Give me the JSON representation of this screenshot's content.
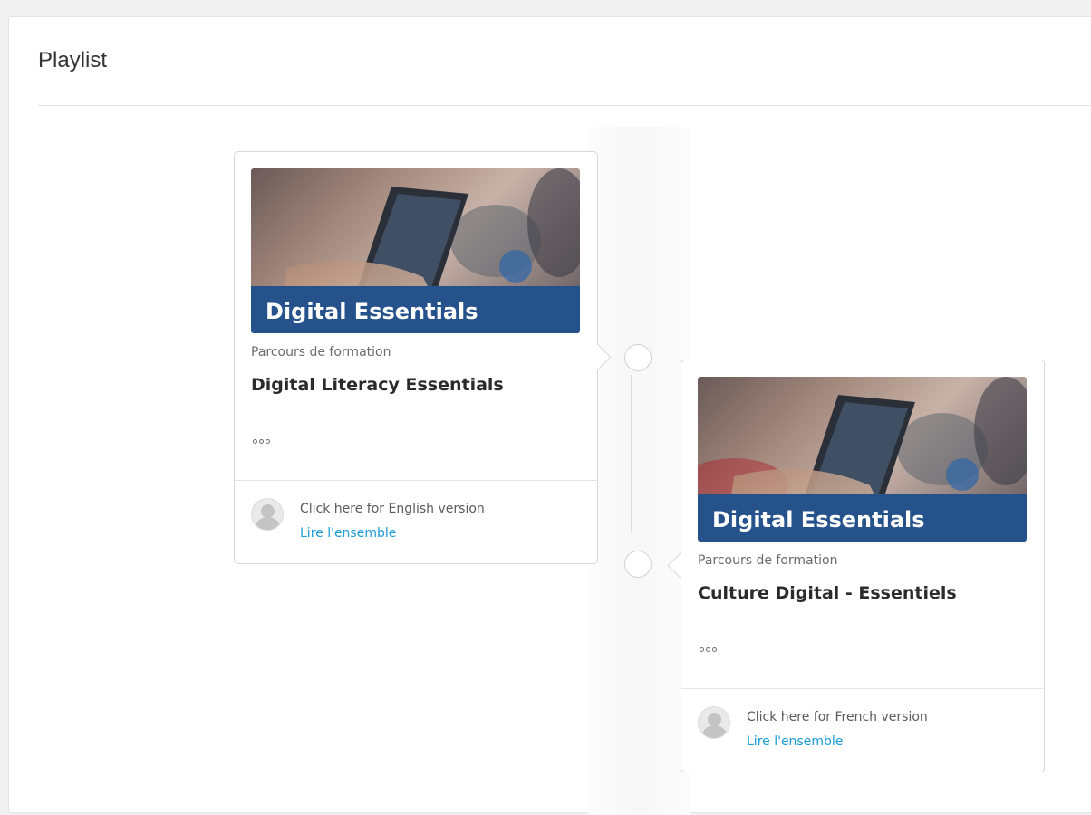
{
  "page": {
    "title": "Playlist"
  },
  "cards": [
    {
      "thumbnail_title": "Digital Essentials",
      "type": "Parcours de formation",
      "title": "Digital Literacy Essentials",
      "description": "Click here for English version",
      "link": "Lire l'ensemble"
    },
    {
      "thumbnail_title": "Digital Essentials",
      "type": "Parcours de formation",
      "title": "Culture Digital - Essentiels",
      "description": "Click here for French version",
      "link": "Lire l'ensemble"
    }
  ],
  "colors": {
    "banner": "#26528c",
    "link": "#1a9ad6"
  }
}
